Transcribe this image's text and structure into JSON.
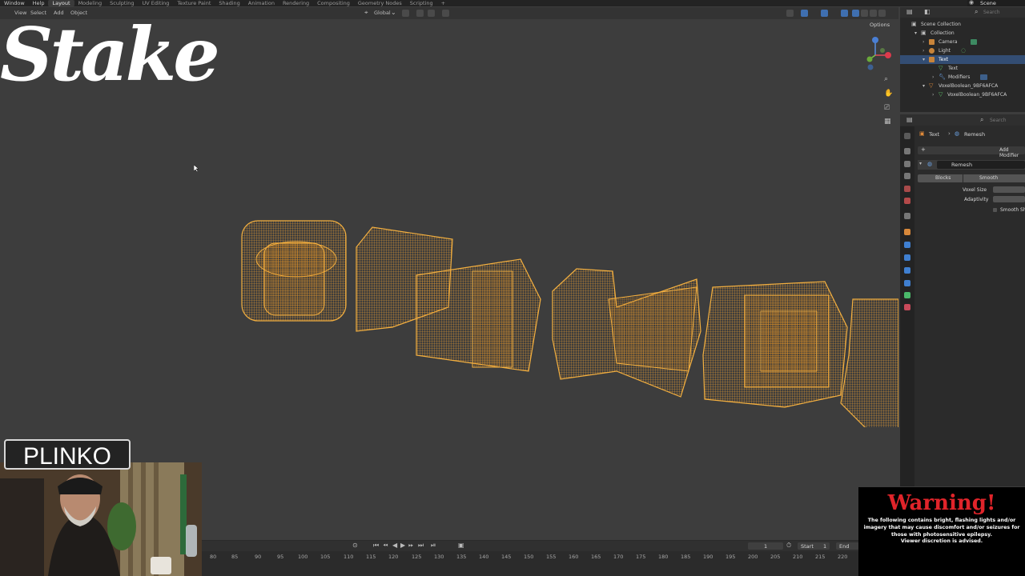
{
  "menubar": {
    "items": [
      "Window",
      "Help"
    ],
    "workspaces": [
      "Layout",
      "Modeling",
      "Sculpting",
      "UV Editing",
      "Texture Paint",
      "Shading",
      "Animation",
      "Rendering",
      "Compositing",
      "Geometry Nodes",
      "Scripting"
    ],
    "active_workspace": "Layout",
    "add_tab": "+",
    "scene_label": "Scene"
  },
  "viewport_header": {
    "menus": [
      "View",
      "Select",
      "Add",
      "Object"
    ],
    "orientation": "Global",
    "options": "Options"
  },
  "outliner": {
    "search_placeholder": "Search",
    "rows": [
      {
        "label": "Scene Collection",
        "indent": 0
      },
      {
        "label": "Collection",
        "indent": 1
      },
      {
        "label": "Camera",
        "indent": 2
      },
      {
        "label": "Light",
        "indent": 2
      },
      {
        "label": "Text",
        "indent": 2,
        "selected": true
      },
      {
        "label": "Text",
        "indent": 3
      },
      {
        "label": "Modifiers",
        "indent": 3
      },
      {
        "label": "VoxelBoolean_9BF6AFCA",
        "indent": 2
      },
      {
        "label": "VoxelBoolean_9BF6AFCA",
        "indent": 3
      }
    ]
  },
  "properties": {
    "search_placeholder": "Search",
    "breadcrumb": [
      "Text",
      "Remesh"
    ],
    "add_modifier": "Add Modifier",
    "modifier_name": "Remesh",
    "modes": [
      "Blocks",
      "Smooth"
    ],
    "fields": [
      {
        "label": "Voxel Size"
      },
      {
        "label": "Adaptivity"
      }
    ],
    "checkbox_label": "Smooth Shading"
  },
  "timeline": {
    "current_frame": "1",
    "start_label": "Start",
    "start_value": "1",
    "end_label": "End",
    "ticks": [
      "80",
      "85",
      "90",
      "95",
      "100",
      "105",
      "110",
      "115",
      "120",
      "125",
      "130",
      "135",
      "140",
      "145",
      "150",
      "155",
      "160",
      "165",
      "170",
      "175",
      "180",
      "185",
      "190",
      "195",
      "200",
      "205",
      "210",
      "215",
      "220"
    ]
  },
  "overlays": {
    "brand": "Stake",
    "plinko": "PLINKO",
    "warning_title": "Warning!",
    "warning_lines": [
      "The following contains bright, flashing lights and/or",
      "imagery that may cause discomfort and/or seizures for",
      "those with photosensitive epilepsy.",
      "Viewer discretion is advised."
    ]
  },
  "colors": {
    "wireframe": "#f0a030",
    "selection": "#334d73",
    "warning_red": "#e0242a"
  }
}
